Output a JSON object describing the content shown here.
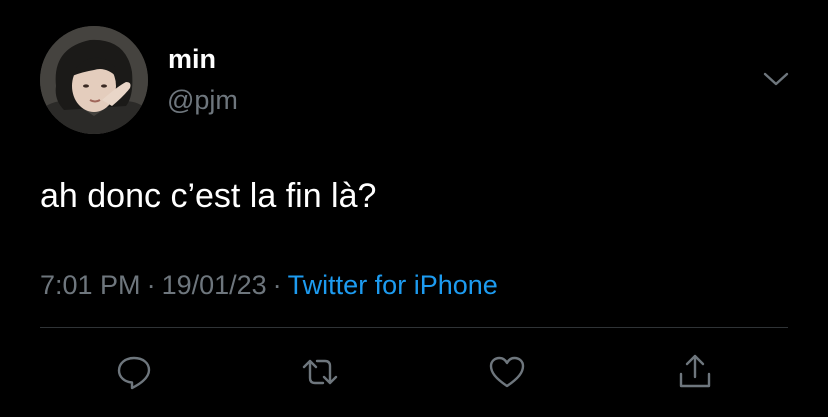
{
  "tweet": {
    "display_name": "min",
    "handle": "@pjm",
    "text": "ah donc c’est la fin là?",
    "time": "7:01 PM",
    "date": "19/01/23",
    "separator": "·",
    "source": "Twitter for iPhone"
  },
  "icons": {
    "menu": "chevron-down-icon",
    "reply": "reply-icon",
    "retweet": "retweet-icon",
    "like": "heart-icon",
    "share": "share-icon"
  },
  "colors": {
    "background": "#000000",
    "primary_text": "#ffffff",
    "secondary_text": "#6e767d",
    "link": "#1d9bf0",
    "divider": "#2f3336"
  }
}
